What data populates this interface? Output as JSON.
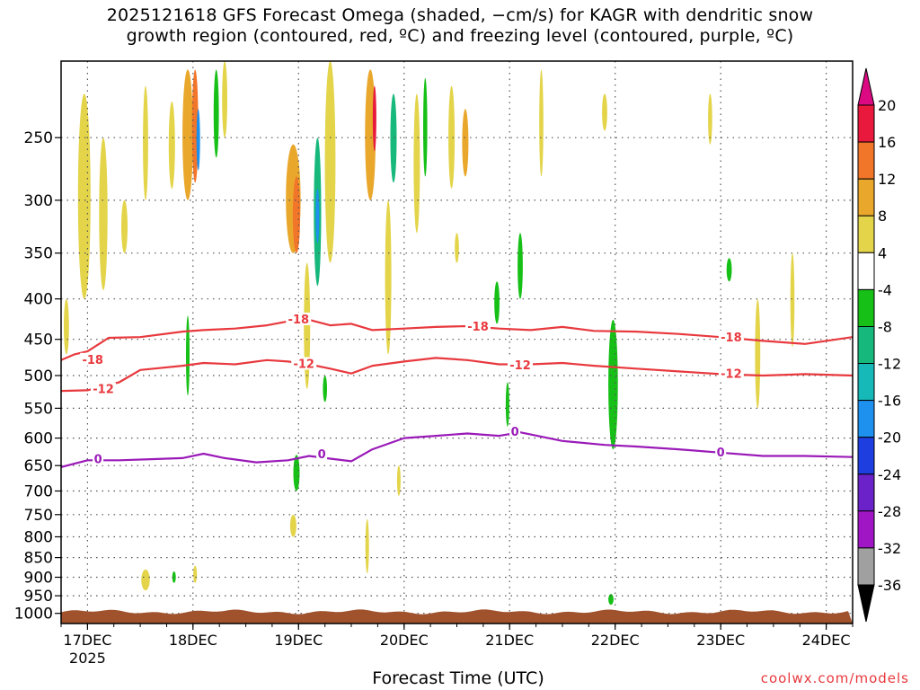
{
  "chart_data": {
    "type": "heatmap",
    "title_line1": "2025121618 GFS Forecast Omega (shaded, −cm/s) for KAGR with dendritic snow",
    "title_line2": "growth region (contoured, red, ºC) and freezing level (contoured, purple, ºC)",
    "xlabel": "Forecast Time (UTC)",
    "ylabel": "",
    "source": "coolwx.com/models",
    "x_ticks": [
      "17DEC",
      "18DEC",
      "19DEC",
      "20DEC",
      "21DEC",
      "22DEC",
      "23DEC",
      "24DEC"
    ],
    "x_year": "2025",
    "x_range_days": [
      16.75,
      24.25
    ],
    "y_axis_type": "log-pressure",
    "y_ticks_hpa": [
      250,
      300,
      350,
      400,
      450,
      500,
      550,
      600,
      650,
      700,
      750,
      800,
      850,
      900,
      950,
      1000
    ],
    "y_range_hpa": [
      200,
      1030
    ],
    "colorbar": {
      "levels": [
        20,
        16,
        12,
        8,
        4,
        -4,
        -8,
        -12,
        -16,
        -20,
        -24,
        -28,
        -32,
        -36
      ],
      "colors": [
        "#e8193c",
        "#f2762a",
        "#e9a72c",
        "#e3d44a",
        "#ffffff",
        "#17c017",
        "#17b87b",
        "#16b8b8",
        "#1e90ee",
        "#1e3ee0",
        "#6b22c8",
        "#a116c4",
        "#a0a0a0"
      ],
      "top_arrow_color": "#dc0a82",
      "bottom_arrow_color": "#000000"
    },
    "contours": [
      {
        "name": "-18",
        "color": "#e8393e",
        "label": "-18",
        "points": [
          [
            16.75,
            478
          ],
          [
            16.88,
            470
          ],
          [
            17.0,
            466
          ],
          [
            17.2,
            448
          ],
          [
            17.5,
            447
          ],
          [
            17.9,
            440
          ],
          [
            18.1,
            438
          ],
          [
            18.4,
            436
          ],
          [
            18.7,
            432
          ],
          [
            18.9,
            427
          ],
          [
            19.1,
            425
          ],
          [
            19.3,
            432
          ],
          [
            19.5,
            430
          ],
          [
            19.7,
            438
          ],
          [
            20.0,
            436
          ],
          [
            20.3,
            434
          ],
          [
            20.6,
            433
          ],
          [
            20.9,
            436
          ],
          [
            21.2,
            438
          ],
          [
            21.5,
            434
          ],
          [
            21.8,
            439
          ],
          [
            22.2,
            440
          ],
          [
            22.6,
            443
          ],
          [
            23.0,
            447
          ],
          [
            23.4,
            452
          ],
          [
            23.8,
            456
          ],
          [
            24.25,
            447
          ]
        ],
        "label_positions": [
          [
            17.05,
            478
          ],
          [
            19.0,
            425
          ],
          [
            20.7,
            434
          ],
          [
            23.1,
            448
          ]
        ]
      },
      {
        "name": "-12",
        "color": "#e8393e",
        "label": "-12",
        "points": [
          [
            16.75,
            523
          ],
          [
            17.0,
            522
          ],
          [
            17.3,
            510
          ],
          [
            17.5,
            492
          ],
          [
            17.9,
            486
          ],
          [
            18.1,
            482
          ],
          [
            18.4,
            484
          ],
          [
            18.7,
            478
          ],
          [
            18.9,
            480
          ],
          [
            19.1,
            484
          ],
          [
            19.3,
            490
          ],
          [
            19.5,
            497
          ],
          [
            19.7,
            486
          ],
          [
            20.0,
            480
          ],
          [
            20.3,
            475
          ],
          [
            20.6,
            478
          ],
          [
            20.9,
            484
          ],
          [
            21.2,
            484
          ],
          [
            21.5,
            482
          ],
          [
            21.8,
            486
          ],
          [
            22.2,
            490
          ],
          [
            22.6,
            494
          ],
          [
            23.0,
            498
          ],
          [
            23.4,
            500
          ],
          [
            23.8,
            498
          ],
          [
            24.25,
            500
          ]
        ],
        "label_positions": [
          [
            17.15,
            521
          ],
          [
            19.05,
            484
          ],
          [
            21.1,
            486
          ],
          [
            23.1,
            498
          ]
        ]
      },
      {
        "name": "0",
        "color": "#9a1ab8",
        "label": "0",
        "points": [
          [
            16.75,
            653
          ],
          [
            17.0,
            640
          ],
          [
            17.3,
            640
          ],
          [
            17.6,
            638
          ],
          [
            17.9,
            636
          ],
          [
            18.1,
            628
          ],
          [
            18.3,
            636
          ],
          [
            18.6,
            644
          ],
          [
            18.9,
            640
          ],
          [
            19.1,
            632
          ],
          [
            19.3,
            637
          ],
          [
            19.5,
            642
          ],
          [
            19.7,
            620
          ],
          [
            20.0,
            600
          ],
          [
            20.3,
            596
          ],
          [
            20.6,
            592
          ],
          [
            20.9,
            596
          ],
          [
            21.1,
            590
          ],
          [
            21.5,
            605
          ],
          [
            21.9,
            612
          ],
          [
            22.2,
            615
          ],
          [
            22.6,
            620
          ],
          [
            23.0,
            626
          ],
          [
            23.4,
            632
          ],
          [
            23.8,
            632
          ],
          [
            24.25,
            634
          ]
        ],
        "label_positions": [
          [
            17.1,
            639
          ],
          [
            19.22,
            630
          ],
          [
            21.05,
            590
          ],
          [
            23.0,
            626
          ]
        ]
      }
    ],
    "shaded_regions": [
      {
        "t": 16.97,
        "p_top": 220,
        "p_bot": 400,
        "w": 0.12,
        "value": 5
      },
      {
        "t": 16.8,
        "p_top": 400,
        "p_bot": 470,
        "w": 0.05,
        "value": 5
      },
      {
        "t": 17.15,
        "p_top": 250,
        "p_bot": 390,
        "w": 0.08,
        "value": 5
      },
      {
        "t": 17.35,
        "p_top": 300,
        "p_bot": 350,
        "w": 0.06,
        "value": 5
      },
      {
        "t": 17.55,
        "p_top": 215,
        "p_bot": 300,
        "w": 0.05,
        "value": 5
      },
      {
        "t": 17.8,
        "p_top": 225,
        "p_bot": 290,
        "w": 0.06,
        "value": 5
      },
      {
        "t": 17.95,
        "p_top": 205,
        "p_bot": 300,
        "w": 0.1,
        "value": 9
      },
      {
        "t": 18.02,
        "p_top": 205,
        "p_bot": 285,
        "w": 0.06,
        "value": 13
      },
      {
        "t": 18.05,
        "p_top": 230,
        "p_bot": 275,
        "w": 0.025,
        "value": -17
      },
      {
        "t": 18.22,
        "p_top": 205,
        "p_bot": 265,
        "w": 0.05,
        "value": -6
      },
      {
        "t": 18.3,
        "p_top": 200,
        "p_bot": 250,
        "w": 0.05,
        "value": 5
      },
      {
        "t": 17.95,
        "p_top": 420,
        "p_bot": 530,
        "w": 0.03,
        "value": -6
      },
      {
        "t": 18.95,
        "p_top": 255,
        "p_bot": 350,
        "w": 0.14,
        "value": 9
      },
      {
        "t": 18.98,
        "p_top": 280,
        "p_bot": 350,
        "w": 0.07,
        "value": 13
      },
      {
        "t": 19.18,
        "p_top": 250,
        "p_bot": 385,
        "w": 0.07,
        "value": -8
      },
      {
        "t": 19.18,
        "p_top": 290,
        "p_bot": 340,
        "w": 0.03,
        "value": -17
      },
      {
        "t": 19.3,
        "p_top": 200,
        "p_bot": 360,
        "w": 0.1,
        "value": 5
      },
      {
        "t": 19.08,
        "p_top": 360,
        "p_bot": 520,
        "w": 0.06,
        "value": 5
      },
      {
        "t": 19.25,
        "p_top": 500,
        "p_bot": 540,
        "w": 0.04,
        "value": -6
      },
      {
        "t": 18.98,
        "p_top": 630,
        "p_bot": 700,
        "w": 0.06,
        "value": -6
      },
      {
        "t": 19.68,
        "p_top": 205,
        "p_bot": 300,
        "w": 0.1,
        "value": 9
      },
      {
        "t": 19.72,
        "p_top": 215,
        "p_bot": 260,
        "w": 0.03,
        "value": 17
      },
      {
        "t": 19.9,
        "p_top": 220,
        "p_bot": 285,
        "w": 0.06,
        "value": -10
      },
      {
        "t": 19.85,
        "p_top": 300,
        "p_bot": 470,
        "w": 0.06,
        "value": 5
      },
      {
        "t": 20.12,
        "p_top": 220,
        "p_bot": 330,
        "w": 0.06,
        "value": 5
      },
      {
        "t": 20.2,
        "p_top": 210,
        "p_bot": 280,
        "w": 0.04,
        "value": -6
      },
      {
        "t": 20.45,
        "p_top": 215,
        "p_bot": 290,
        "w": 0.06,
        "value": 5
      },
      {
        "t": 20.58,
        "p_top": 230,
        "p_bot": 280,
        "w": 0.06,
        "value": 9
      },
      {
        "t": 20.5,
        "p_top": 330,
        "p_bot": 360,
        "w": 0.04,
        "value": 5
      },
      {
        "t": 20.88,
        "p_top": 380,
        "p_bot": 430,
        "w": 0.05,
        "value": -6
      },
      {
        "t": 21.1,
        "p_top": 330,
        "p_bot": 400,
        "w": 0.05,
        "value": -6
      },
      {
        "t": 20.98,
        "p_top": 510,
        "p_bot": 580,
        "w": 0.03,
        "value": -6
      },
      {
        "t": 21.3,
        "p_top": 205,
        "p_bot": 280,
        "w": 0.04,
        "value": 5
      },
      {
        "t": 21.9,
        "p_top": 220,
        "p_bot": 245,
        "w": 0.05,
        "value": 5
      },
      {
        "t": 21.98,
        "p_top": 425,
        "p_bot": 620,
        "w": 0.09,
        "value": -6
      },
      {
        "t": 21.96,
        "p_top": 945,
        "p_bot": 975,
        "w": 0.05,
        "value": -6
      },
      {
        "t": 22.9,
        "p_top": 220,
        "p_bot": 255,
        "w": 0.04,
        "value": 5
      },
      {
        "t": 23.08,
        "p_top": 355,
        "p_bot": 380,
        "w": 0.05,
        "value": -6
      },
      {
        "t": 23.35,
        "p_top": 400,
        "p_bot": 550,
        "w": 0.05,
        "value": 5
      },
      {
        "t": 23.68,
        "p_top": 350,
        "p_bot": 460,
        "w": 0.04,
        "value": 5
      },
      {
        "t": 19.95,
        "p_top": 650,
        "p_bot": 710,
        "w": 0.02,
        "value": 5
      },
      {
        "t": 18.95,
        "p_top": 750,
        "p_bot": 800,
        "w": 0.06,
        "value": 5
      },
      {
        "t": 19.65,
        "p_top": 760,
        "p_bot": 890,
        "w": 0.03,
        "value": 5
      },
      {
        "t": 17.55,
        "p_top": 880,
        "p_bot": 935,
        "w": 0.08,
        "value": 5
      },
      {
        "t": 18.02,
        "p_top": 870,
        "p_bot": 915,
        "w": 0.03,
        "value": 5
      },
      {
        "t": 17.82,
        "p_top": 885,
        "p_bot": 915,
        "w": 0.02,
        "value": -6
      }
    ],
    "surface_fill_color": "#a0522d"
  }
}
